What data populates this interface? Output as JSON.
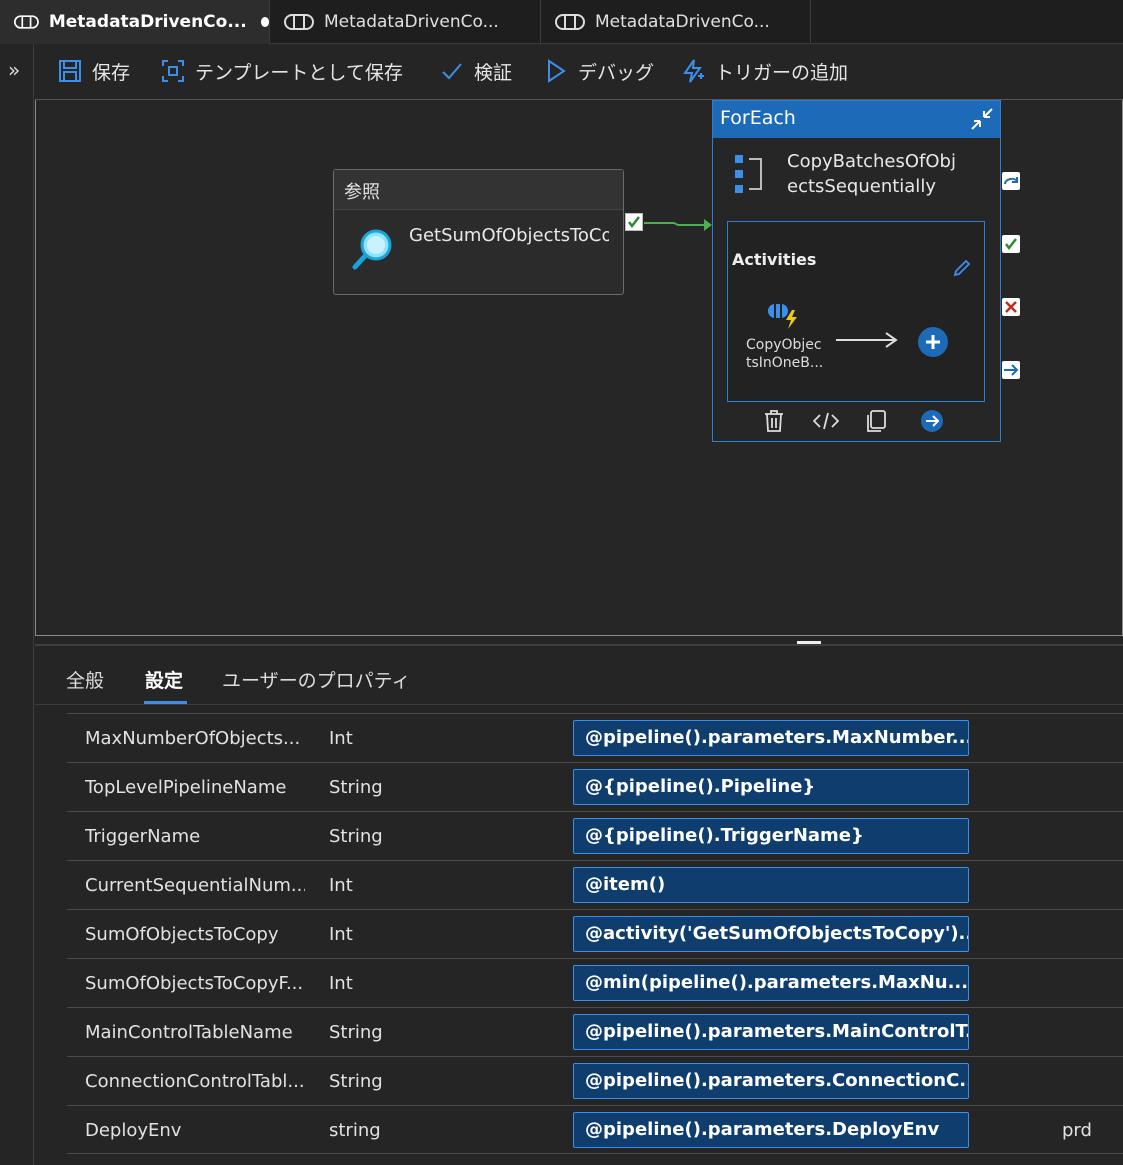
{
  "tabs": [
    {
      "label": "MetadataDrivenCo...",
      "active": true,
      "unsaved": true
    },
    {
      "label": "MetadataDrivenCo...",
      "active": false,
      "unsaved": false
    },
    {
      "label": "MetadataDrivenCo...",
      "active": false,
      "unsaved": false
    }
  ],
  "sidebar": {
    "expand_glyph": "»"
  },
  "toolbar": {
    "save": "保存",
    "save_as_template": "テンプレートとして保存",
    "validate": "検証",
    "debug": "デバッグ",
    "add_trigger": "トリガーの追加"
  },
  "canvas": {
    "lookup": {
      "type": "参照",
      "name": "GetSumOfObjectsToCopy"
    },
    "foreach": {
      "type": "ForEach",
      "name_line1": "CopyBatchesOfObj",
      "name_line2": "ectsSequentially",
      "activities_label": "Activities",
      "child": {
        "name_line1": "CopyObjec",
        "name_line2": "tsInOneB..."
      }
    }
  },
  "panel": {
    "tabs": [
      "全般",
      "設定",
      "ユーザーのプロパティ"
    ],
    "active_tab": "設定",
    "rows": [
      {
        "name": "MaxNumberOfObjects...",
        "type": "Int",
        "value": "@pipeline().parameters.MaxNumber...",
        "default": ""
      },
      {
        "name": "TopLevelPipelineName",
        "type": "String",
        "value": "@{pipeline().Pipeline}",
        "default": ""
      },
      {
        "name": "TriggerName",
        "type": "String",
        "value": "@{pipeline().TriggerName}",
        "default": ""
      },
      {
        "name": "CurrentSequentialNum...",
        "type": "Int",
        "value": "@item()",
        "default": ""
      },
      {
        "name": "SumOfObjectsToCopy",
        "type": "Int",
        "value": "@activity('GetSumOfObjectsToCopy')...",
        "default": ""
      },
      {
        "name": "SumOfObjectsToCopyF...",
        "type": "Int",
        "value": "@min(pipeline().parameters.MaxNu...",
        "default": ""
      },
      {
        "name": "MainControlTableName",
        "type": "String",
        "value": "@pipeline().parameters.MainControlT...",
        "default": ""
      },
      {
        "name": "ConnectionControlTabl...",
        "type": "String",
        "value": "@pipeline().parameters.ConnectionC...",
        "default": ""
      },
      {
        "name": "DeployEnv",
        "type": "string",
        "value": "@pipeline().parameters.DeployEnv",
        "default": "prd"
      }
    ]
  },
  "colors": {
    "accent": "#1d6ab8",
    "success": "#2e8b2e",
    "fail": "#c42b1c",
    "value_bg": "#0e3d6e"
  }
}
